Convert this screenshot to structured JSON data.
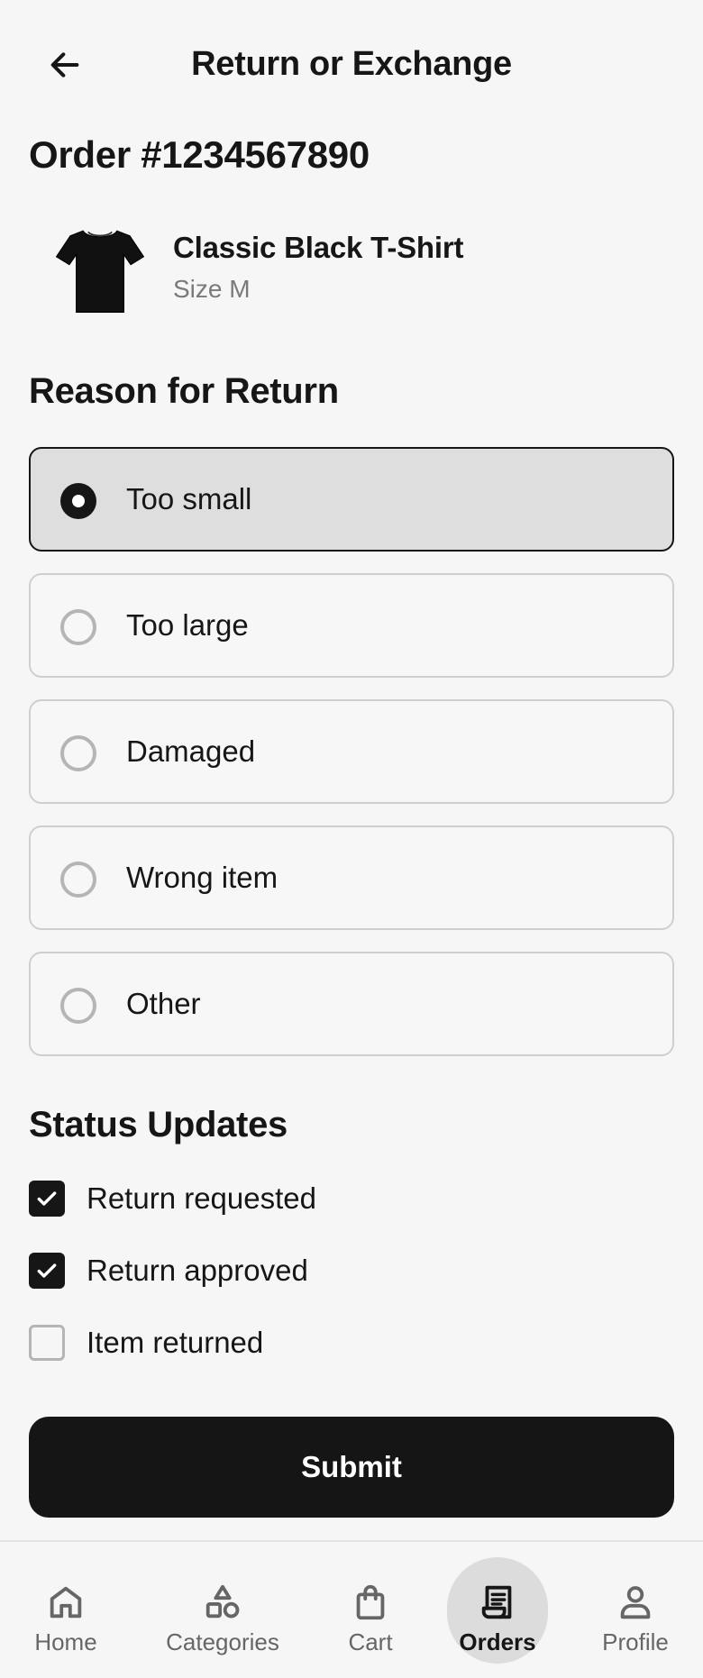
{
  "header": {
    "title": "Return or Exchange",
    "back_icon": "arrow-left-icon"
  },
  "order": {
    "title": "Order #1234567890"
  },
  "product": {
    "name": "Classic Black T-Shirt",
    "size": "Size M",
    "image_icon": "tshirt-icon"
  },
  "reason_section": {
    "title": "Reason for Return",
    "selected": "Too small",
    "options": [
      {
        "label": "Too small",
        "selected": true
      },
      {
        "label": "Too large",
        "selected": false
      },
      {
        "label": "Damaged",
        "selected": false
      },
      {
        "label": "Wrong item",
        "selected": false
      },
      {
        "label": "Other",
        "selected": false
      }
    ]
  },
  "status_section": {
    "title": "Status Updates",
    "items": [
      {
        "label": "Return requested",
        "checked": true
      },
      {
        "label": "Return approved",
        "checked": true
      },
      {
        "label": "Item returned",
        "checked": false
      }
    ]
  },
  "submit": {
    "label": "Submit"
  },
  "bottom_nav": {
    "active": "Orders",
    "items": [
      {
        "label": "Home",
        "icon": "home-icon"
      },
      {
        "label": "Categories",
        "icon": "categories-icon"
      },
      {
        "label": "Cart",
        "icon": "shopping-bag-icon"
      },
      {
        "label": "Orders",
        "icon": "receipt-icon"
      },
      {
        "label": "Profile",
        "icon": "person-icon"
      }
    ]
  },
  "colors": {
    "primary": "#151515",
    "background": "#f6f6f6",
    "selected_bg": "#dedede",
    "border": "#cfcfcf",
    "muted_text": "#7a7a7a"
  }
}
